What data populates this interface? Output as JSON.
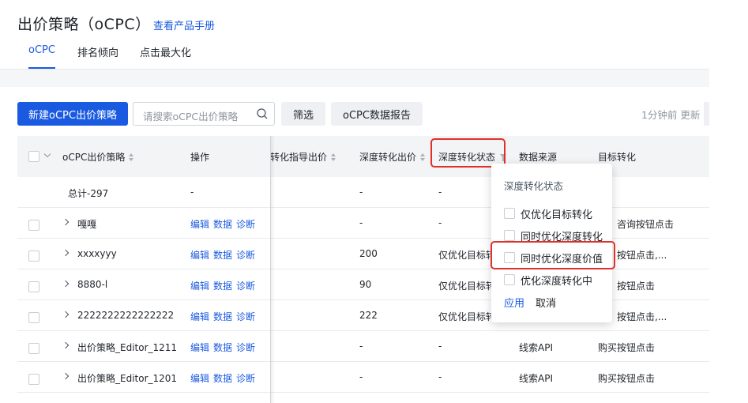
{
  "header": {
    "title": "出价策略（oCPC）",
    "manual_link": "查看产品手册",
    "tabs": [
      {
        "label": "oCPC",
        "active": true
      },
      {
        "label": "排名倾向",
        "active": false
      },
      {
        "label": "点击最大化",
        "active": false
      }
    ]
  },
  "toolbar": {
    "new_button": "新建oCPC出价策略",
    "search_placeholder": "请搜索oCPC出价策略",
    "filter_button": "筛选",
    "report_button": "oCPC数据报告",
    "update_text": "1分钟前 更新"
  },
  "table": {
    "columns": {
      "name": "oCPC出价策略",
      "actions": "操作",
      "guide_bid": "转化指导出价",
      "deep_bid": "深度转化出价",
      "deep_status": "深度转化状态",
      "data_source": "数据来源",
      "target": "目标转化"
    },
    "total_row": {
      "name": "总计-297",
      "actions": "-",
      "deep_bid": "-",
      "deep_status": "-"
    },
    "action_labels": {
      "edit": "编辑",
      "data": "数据",
      "diagnose": "诊断"
    },
    "rows": [
      {
        "name": "嘎嘎",
        "deep_bid": "-",
        "deep_status": "-",
        "data_source": "",
        "target": "咨询按钮点击"
      },
      {
        "name": "xxxxyyy",
        "deep_bid": "200",
        "deep_status": "仅优化目标转",
        "data_source": "",
        "target": "按钮点击,..."
      },
      {
        "name": "8880-l",
        "deep_bid": "90",
        "deep_status": "仅优化目标转",
        "data_source": "",
        "target": "按钮点击"
      },
      {
        "name": "2222222222222222",
        "deep_bid": "222",
        "deep_status": "仅优化目标转",
        "data_source": "",
        "target": "按钮点击,..."
      },
      {
        "name": "出价策略_Editor_1211",
        "deep_bid": "-",
        "deep_status": "-",
        "data_source": "线索API",
        "target": "购买按钮点击"
      },
      {
        "name": "出价策略_Editor_1201",
        "deep_bid": "-",
        "deep_status": "-",
        "data_source": "线索API",
        "target": "购买按钮点击"
      }
    ]
  },
  "filter_dropdown": {
    "title": "深度转化状态",
    "options": [
      "仅优化目标转化",
      "同时优化深度转化",
      "同时优化深度价值",
      "优化深度转化中"
    ],
    "apply": "应用",
    "cancel": "取消"
  },
  "colors": {
    "primary": "#1a5ae0",
    "highlight": "#e0302a",
    "header_bg": "#f3f4f6"
  }
}
